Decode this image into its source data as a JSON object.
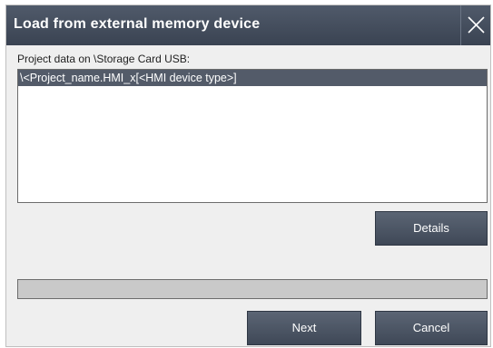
{
  "dialog": {
    "title": "Load from external memory device",
    "close_icon": "close-icon"
  },
  "content": {
    "label": "Project data on \\Storage Card USB:",
    "list_items": [
      "\\<Project_name.HMI_x[<HMI device type>]"
    ],
    "selected_index": 0
  },
  "buttons": {
    "details_label": "Details",
    "next_label": "Next",
    "cancel_label": "Cancel"
  },
  "progress": {
    "value_percent": 0
  },
  "colors": {
    "titlebar": "#46505f",
    "button": "#4d5766",
    "selection": "#535b69",
    "dialog_background": "#efefef"
  }
}
